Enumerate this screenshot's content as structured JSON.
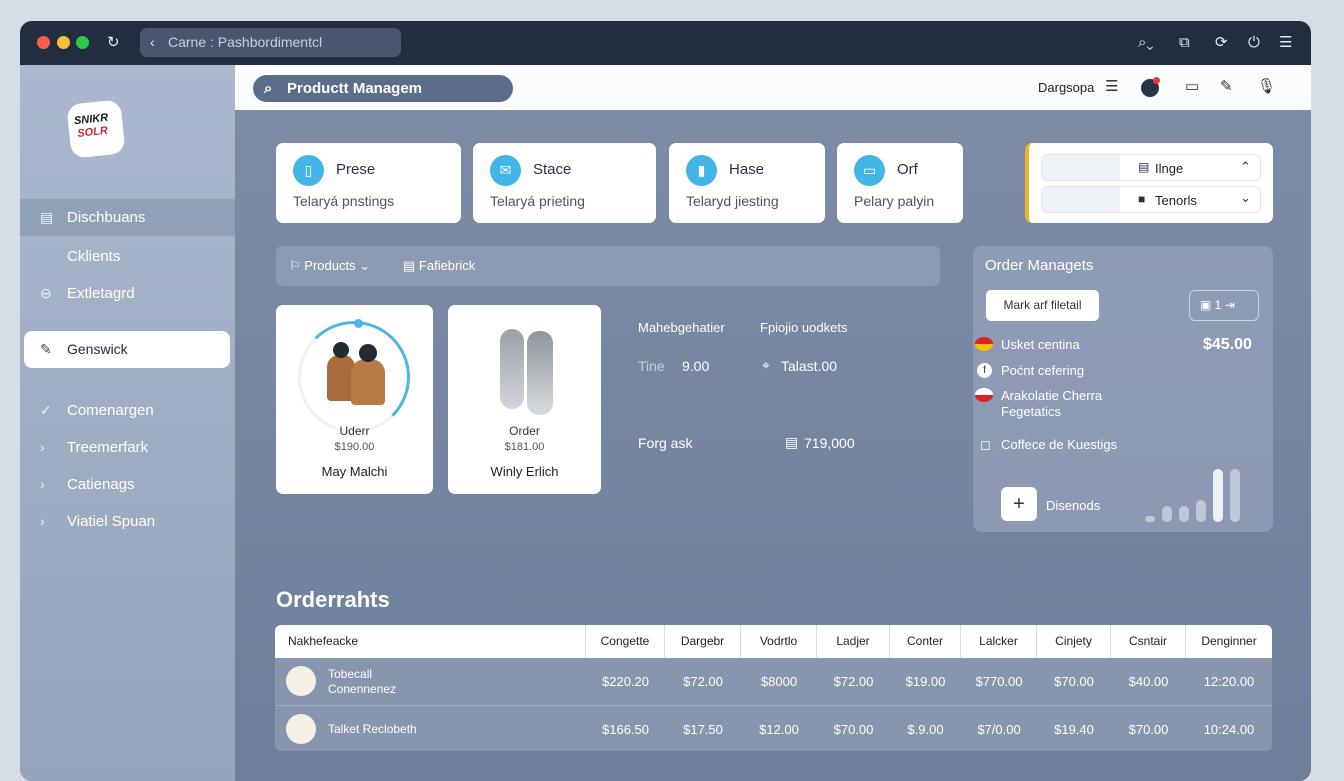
{
  "window": {
    "address": "Carne : Pashbordimentcl"
  },
  "logo": {
    "line1": "SNIKR",
    "line2": "SOLR"
  },
  "sidebar": {
    "items": [
      {
        "label": "Dischbuans"
      },
      {
        "label": "Cklients"
      },
      {
        "label": "Extletagrd"
      },
      {
        "label": "Genswick"
      },
      {
        "label": "Comenargen"
      },
      {
        "label": "Treemerfark"
      },
      {
        "label": "Catienags"
      },
      {
        "label": "Viatiel Spuan"
      }
    ]
  },
  "topbar": {
    "search": "Productt Managem",
    "user": "Dargsopa"
  },
  "stats": [
    {
      "title": "Prese",
      "sub": "Telaryá pnstings",
      "icon": "phone-icon"
    },
    {
      "title": "Stace",
      "sub": "Telaryá prieting",
      "icon": "mail-icon"
    },
    {
      "title": "Hase",
      "sub": "Telaryd jiesting",
      "icon": "bar-chart-icon"
    },
    {
      "title": "Orf",
      "sub": "Pelary palyin",
      "icon": "card-icon"
    }
  ],
  "dropdowns": [
    {
      "label": "Ilnge"
    },
    {
      "label": "Tenorls"
    }
  ],
  "products_bar": {
    "products": "Products",
    "filter": "Fafiebrick"
  },
  "products": [
    {
      "label": "Uderr",
      "price": "$190.00",
      "name": "May Malchi"
    },
    {
      "label": "Order",
      "price": "$181.00",
      "name": "Winly Erlich"
    }
  ],
  "details": {
    "h1": "Mahebgehatier",
    "h2": "Fpiojio uodkets",
    "time_label": "Tine",
    "time_value": "9.00",
    "loc_value": "Talast.00",
    "forg": "Forg ask",
    "forg_value": "719,000"
  },
  "order_mgmt": {
    "title": "Order Managets",
    "mark_button": "Mark arf filetail",
    "count": "1",
    "price": "$45.00",
    "items": [
      "Usket centina",
      "Poćnt cefering",
      "Arakolatie Cherra",
      "Fegetatics"
    ],
    "note": "Coffece de Kuestigs",
    "add_label": "Disenods",
    "bars": [
      0.12,
      0.3,
      0.3,
      0.4,
      0.98,
      0.98
    ]
  },
  "orders": {
    "title": "Orderrahts",
    "headers": [
      "Nakhefeacke",
      "Congette",
      "Dargebr",
      "Vodrtlo",
      "Ladjer",
      "Conter",
      "Lalcker",
      "Cinjety",
      "Csntair",
      "Denginner"
    ],
    "rows": [
      {
        "name1": "Tobecall",
        "name2": "Conennenez",
        "cells": [
          "$220.20",
          "$72.00",
          "$8000",
          "$72.00",
          "$19.00",
          "$770.00",
          "$70.00",
          "$40.00",
          "12:20.00"
        ]
      },
      {
        "name1": "Talket Reclobeth",
        "name2": "",
        "cells": [
          "$166.50",
          "$17.50",
          "$12.00",
          "$70.00",
          "$.9.00",
          "$7/0.00",
          "$19.40",
          "$70.00",
          "10:24.00"
        ]
      }
    ]
  }
}
